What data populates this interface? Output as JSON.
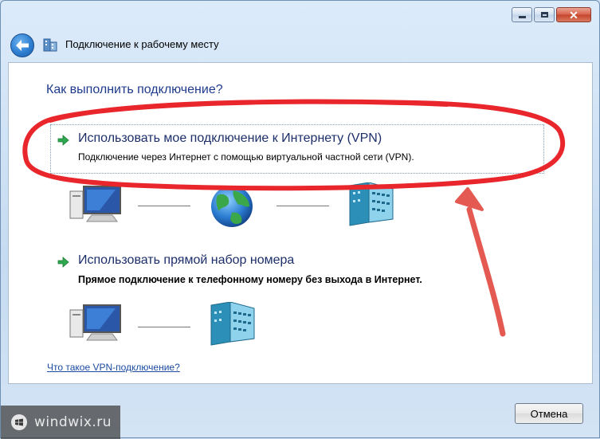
{
  "window": {
    "title": "Подключение к рабочему месту",
    "caption_buttons": {
      "minimize": "minimize-icon",
      "maximize": "maximize-icon",
      "close": "close-icon"
    }
  },
  "main": {
    "question": "Как выполнить подключение?",
    "options": [
      {
        "title": "Использовать мое подключение к Интернету (VPN)",
        "description": "Подключение через Интернет с помощью виртуальной частной сети (VPN).",
        "icons": [
          "computer-icon",
          "globe-icon",
          "server-icon"
        ]
      },
      {
        "title": "Использовать прямой набор номера",
        "description": "Прямое подключение к телефонному номеру без выхода в Интернет.",
        "icons": [
          "computer-icon",
          "server-icon"
        ]
      }
    ],
    "help_link": "Что такое VPN-подключение?"
  },
  "footer": {
    "cancel_label": "Отмена"
  },
  "watermark": {
    "text": "windwix.ru"
  },
  "colors": {
    "accent_red": "#e8262b",
    "heading_blue": "#1e3a8c",
    "link_blue": "#1a4ba0"
  }
}
